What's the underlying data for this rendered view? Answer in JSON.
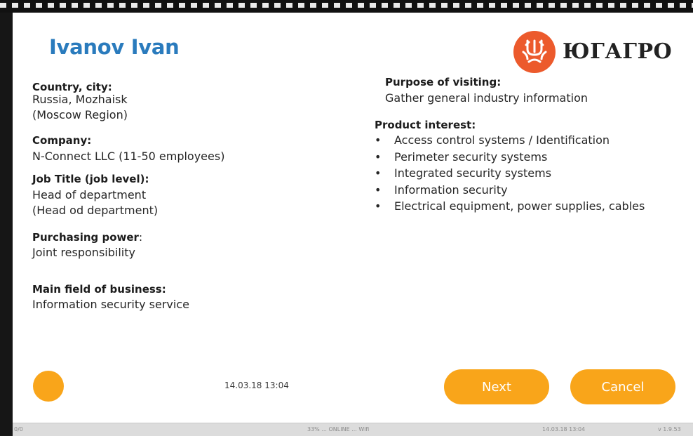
{
  "visitor": {
    "name": "Ivanov Ivan"
  },
  "logo": {
    "text": "ЮГАГРО",
    "color": "#ec5a2c"
  },
  "fields": {
    "country_label": "Country, city:",
    "country_line1": "Russia, Mozhaisk",
    "country_line2": "(Moscow Region)",
    "company_label": "Company:",
    "company_value": "N-Connect LLC (11-50 employees)",
    "job_label": "Job Title (job level):",
    "job_line1": "Head of department",
    "job_line2": "(Head od department)",
    "purchasing_label": "Purchasing power",
    "purchasing_colon": ":",
    "purchasing_value": "Joint responsibility",
    "business_label": "Main field of business:",
    "business_value": "Information security service",
    "purpose_label": "Purpose of visiting:",
    "purpose_value": "Gather general industry information",
    "interest_label": "Product interest:",
    "interests": [
      "Access control systems / Identification",
      "Perimeter security systems",
      "Integrated security systems",
      "Information security",
      "Electrical equipment, power supplies, cables"
    ]
  },
  "status": {
    "timestamp": "14.03.18 13:04",
    "indicator_color": "#f9a51a"
  },
  "buttons": {
    "next_label": "Next",
    "cancel_label": "Cancel",
    "color": "#f9a51a"
  },
  "footer": {
    "left": "0/0",
    "center": "33%  ...  ONLINE  ...  Wifi",
    "time": "14.03.18 13:04",
    "version": "v 1.9.53"
  }
}
